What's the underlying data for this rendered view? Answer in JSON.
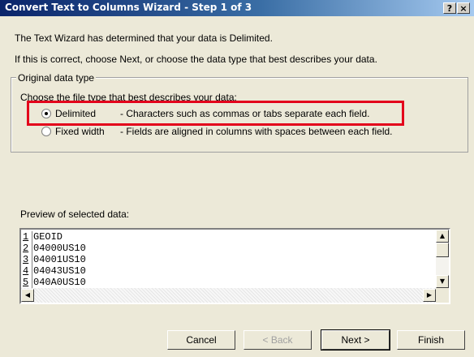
{
  "window": {
    "title": "Convert Text to Columns Wizard - Step 1 of 3",
    "help_button": "?",
    "close_button": "×"
  },
  "intro": {
    "line1": "The Text Wizard has determined that your data is Delimited.",
    "line2": "If this is correct, choose Next, or choose the data type that best describes your data."
  },
  "group": {
    "legend": "Original data type",
    "prompt": "Choose the file type that best describes your data:",
    "options": [
      {
        "label": "Delimited",
        "description": "- Characters such as commas or tabs separate each field.",
        "selected": true
      },
      {
        "label": "Fixed width",
        "description": "- Fields are aligned in columns with spaces between each field.",
        "selected": false
      }
    ]
  },
  "preview": {
    "label": "Preview of selected data:",
    "rows": [
      {
        "n": "1",
        "value": "GEOID"
      },
      {
        "n": "2",
        "value": "04000US10"
      },
      {
        "n": "3",
        "value": "04001US10"
      },
      {
        "n": "4",
        "value": "04043US10"
      },
      {
        "n": "5",
        "value": "040A0US10"
      }
    ]
  },
  "buttons": {
    "cancel": "Cancel",
    "back": "< Back",
    "next": "Next >",
    "finish": "Finish"
  },
  "colors": {
    "highlight": "#e3001b",
    "titlebar": "#0a246a"
  }
}
